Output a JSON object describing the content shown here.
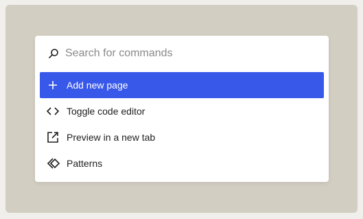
{
  "palette": {
    "search": {
      "placeholder": "Search for commands",
      "icon": "search-icon"
    },
    "commands": [
      {
        "label": "Add new page",
        "icon": "plus-icon",
        "active": true
      },
      {
        "label": "Toggle code editor",
        "icon": "code-icon",
        "active": false
      },
      {
        "label": "Preview in a new tab",
        "icon": "external-link-icon",
        "active": false
      },
      {
        "label": "Patterns",
        "icon": "symbol-icon",
        "active": false
      }
    ]
  },
  "colors": {
    "backdrop": "#d2cec2",
    "highlight": "#3858e9",
    "text": "#1e1e1e",
    "placeholder": "#8a8a8a"
  }
}
